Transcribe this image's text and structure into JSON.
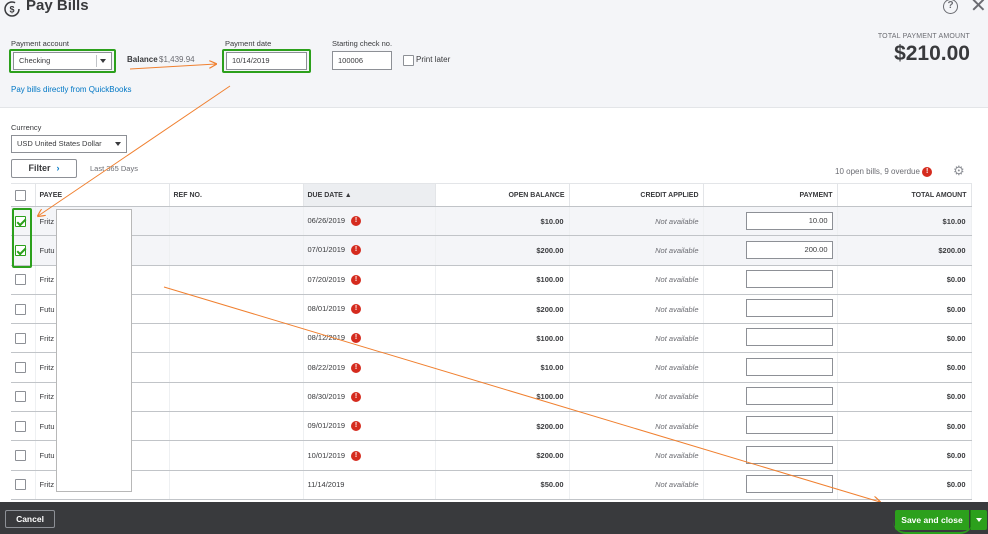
{
  "window": {
    "title": "Pay Bills",
    "help_glyph": "?",
    "close_glyph": "✕"
  },
  "header": {
    "payment_account_label": "Payment account",
    "payment_account_value": "Checking",
    "balance_label": "Balance",
    "balance_value": "$1,439.94",
    "payment_date_label": "Payment date",
    "payment_date_value": "10/14/2019",
    "check_no_label": "Starting check no.",
    "check_no_value": "100006",
    "print_later_label": "Print later",
    "pay_online_link": "Pay bills directly from QuickBooks",
    "total_label": "TOTAL PAYMENT AMOUNT",
    "total_value": "$210.00"
  },
  "filters": {
    "currency_label": "Currency",
    "currency_value": "USD United States Dollar",
    "filter_button": "Filter",
    "filter_chevron": "›",
    "date_range": "Last 365 Days",
    "open_bills_summary": "10 open bills, 9 overdue",
    "alert_glyph": "!",
    "settings_icon": "gear-icon",
    "settings_glyph": "⚙"
  },
  "table": {
    "columns": [
      "PAYEE",
      "REF NO.",
      "DUE DATE ▲",
      "OPEN BALANCE",
      "CREDIT APPLIED",
      "PAYMENT",
      "TOTAL AMOUNT"
    ],
    "rows": [
      {
        "checked": true,
        "payee": "Fritz",
        "ref": "",
        "due": "06/26/2019",
        "overdue": true,
        "open": "$10.00",
        "credit": "Not available",
        "payment": "10.00",
        "total": "$10.00"
      },
      {
        "checked": true,
        "payee": "Futu",
        "ref": "",
        "due": "07/01/2019",
        "overdue": true,
        "open": "$200.00",
        "credit": "Not available",
        "payment": "200.00",
        "total": "$200.00"
      },
      {
        "checked": false,
        "payee": "Fritz",
        "ref": "",
        "due": "07/20/2019",
        "overdue": true,
        "open": "$100.00",
        "credit": "Not available",
        "payment": "",
        "total": "$0.00"
      },
      {
        "checked": false,
        "payee": "Futu",
        "ref": "",
        "due": "08/01/2019",
        "overdue": true,
        "open": "$200.00",
        "credit": "Not available",
        "payment": "",
        "total": "$0.00"
      },
      {
        "checked": false,
        "payee": "Fritz",
        "ref": "",
        "due": "08/12/2019",
        "overdue": true,
        "open": "$100.00",
        "credit": "Not available",
        "payment": "",
        "total": "$0.00"
      },
      {
        "checked": false,
        "payee": "Fritz",
        "ref": "",
        "due": "08/22/2019",
        "overdue": true,
        "open": "$10.00",
        "credit": "Not available",
        "payment": "",
        "total": "$0.00"
      },
      {
        "checked": false,
        "payee": "Fritz",
        "ref": "",
        "due": "08/30/2019",
        "overdue": true,
        "open": "$100.00",
        "credit": "Not available",
        "payment": "",
        "total": "$0.00"
      },
      {
        "checked": false,
        "payee": "Futu",
        "ref": "",
        "due": "09/01/2019",
        "overdue": true,
        "open": "$200.00",
        "credit": "Not available",
        "payment": "",
        "total": "$0.00"
      },
      {
        "checked": false,
        "payee": "Futu",
        "ref": "",
        "due": "10/01/2019",
        "overdue": true,
        "open": "$200.00",
        "credit": "Not available",
        "payment": "",
        "total": "$0.00"
      },
      {
        "checked": false,
        "payee": "Fritz",
        "ref": "",
        "due": "11/14/2019",
        "overdue": false,
        "open": "$50.00",
        "credit": "Not available",
        "payment": "",
        "total": "$0.00"
      }
    ]
  },
  "footer": {
    "cancel": "Cancel",
    "save_and_close": "Save and close"
  },
  "colors": {
    "accent_green": "#2ca01c",
    "link_blue": "#0077c5",
    "alert_red": "#d52b1e",
    "annotation_orange": "#f08030",
    "footer_bg": "#393a3d"
  }
}
